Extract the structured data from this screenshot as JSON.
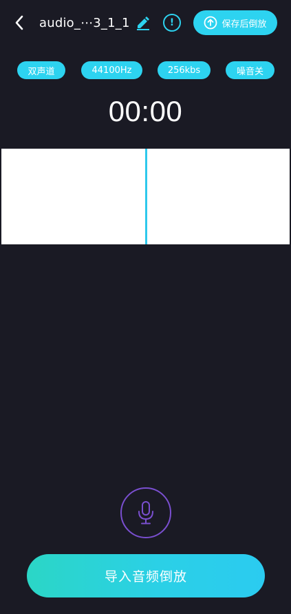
{
  "header": {
    "title": "audio_⋯3_1_1",
    "back_icon": "chevron-left-icon",
    "edit_icon": "pencil-icon",
    "info_icon": "exclamation-circle-icon",
    "save_label": "保存后倒放",
    "save_icon": "upload-circle-icon"
  },
  "chips": [
    {
      "label": "双声道"
    },
    {
      "label": "44100Hz"
    },
    {
      "label": "256kbs"
    },
    {
      "label": "噪音关"
    }
  ],
  "timer": "00:00",
  "mic_icon": "microphone-icon",
  "import_label": "导入音频倒放",
  "colors": {
    "background": "#1a1a24",
    "accent": "#2dd3f0",
    "mic_ring": "#7a4fd0",
    "import_gradient_start": "#2bd6c6",
    "import_gradient_end": "#2bcbf0"
  }
}
